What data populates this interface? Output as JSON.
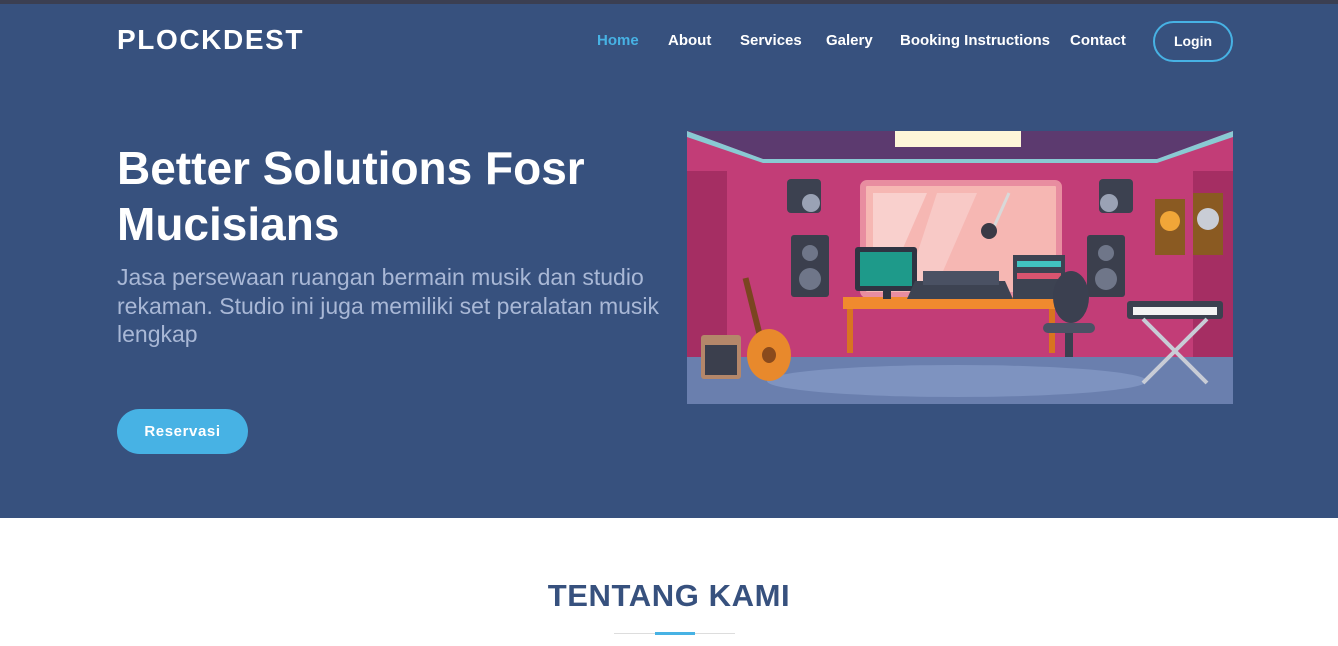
{
  "brand": {
    "name": "PLOCKDEST"
  },
  "nav": {
    "items": [
      {
        "label": "Home",
        "active": true
      },
      {
        "label": "About",
        "active": false
      },
      {
        "label": "Services",
        "active": false
      },
      {
        "label": "Galery",
        "active": false
      },
      {
        "label": "Booking Instructions",
        "active": false
      },
      {
        "label": "Contact",
        "active": false
      }
    ],
    "login_label": "Login"
  },
  "hero": {
    "title": "Better Solutions Fosr Mucisians",
    "subtitle": "Jasa persewaan ruangan bermain musik dan studio rekaman. Studio ini juga memiliki set peralatan musik lengkap",
    "cta_label": "Reservasi",
    "illustration": "recording-studio-illustration"
  },
  "about": {
    "title": "TENTANG KAMI"
  },
  "colors": {
    "hero_bg": "#37517e",
    "accent": "#47b2e4",
    "text_light": "#ffffff",
    "subtitle": "#a9b8d6",
    "heading_dark": "#37517e"
  }
}
